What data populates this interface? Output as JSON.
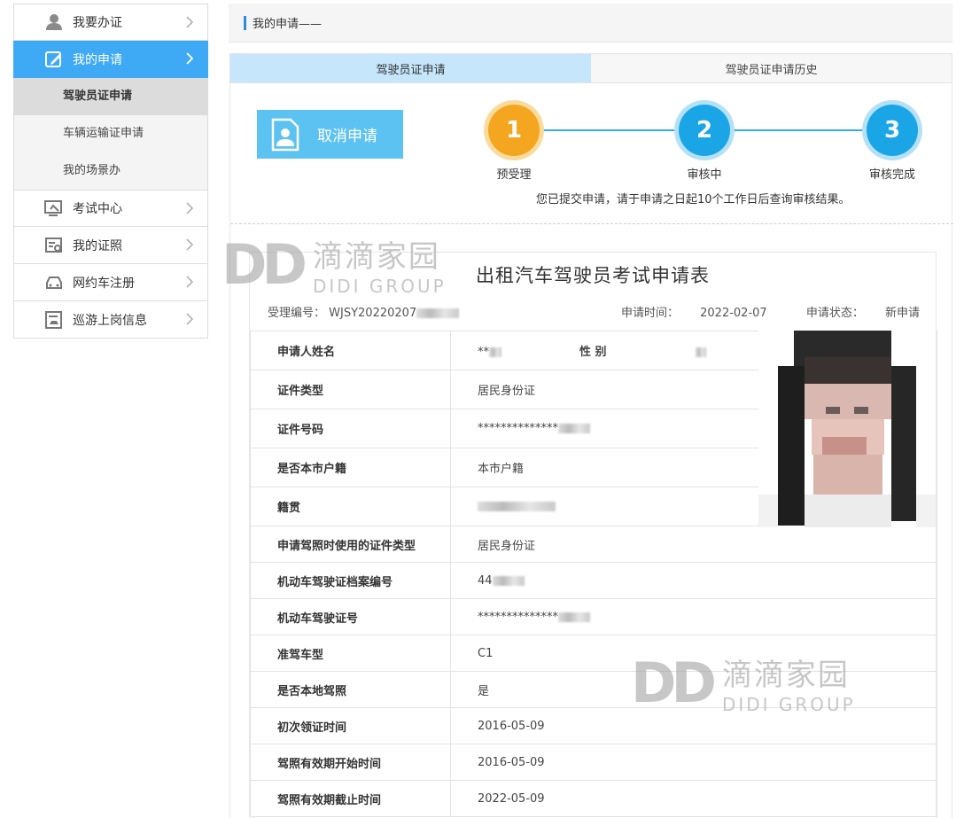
{
  "sidebar": {
    "items": [
      {
        "label": "我要办证",
        "icon": "person-icon"
      },
      {
        "label": "我的申请",
        "icon": "edit-icon"
      },
      {
        "label": "考试中心",
        "icon": "monitor-icon"
      },
      {
        "label": "我的证照",
        "icon": "certificate-icon"
      },
      {
        "label": "网约车注册",
        "icon": "car-icon"
      },
      {
        "label": "巡游上岗信息",
        "icon": "taxi-card-icon"
      }
    ],
    "submenu": [
      "驾驶员证申请",
      "车辆运输证申请",
      "我的场景办"
    ]
  },
  "breadcrumb": "我的申请——",
  "tabs": [
    "驾驶员证申请",
    "驾驶员证申请历史"
  ],
  "cancel_button": "取消申请",
  "steps": [
    {
      "num": "1",
      "label": "预受理",
      "color": "#f4a620"
    },
    {
      "num": "2",
      "label": "审核中",
      "color": "#1aa6e6"
    },
    {
      "num": "3",
      "label": "审核完成",
      "color": "#1aa6e6"
    }
  ],
  "notice": "您已提交申请，请于申请之日起10个工作日后查询审核结果。",
  "form": {
    "title": "出租汽车驾驶员考试申请表",
    "accept_no_label": "受理编号：",
    "accept_no": "WJSY20220207",
    "apply_time_label": "申请时间：",
    "apply_time": "2022-02-07",
    "status_label": "申请状态：",
    "status": "新申请",
    "gender_label": "性 别",
    "rows": [
      {
        "label": "申请人姓名",
        "value": "**"
      },
      {
        "label": "证件类型",
        "value": "居民身份证"
      },
      {
        "label": "证件号码",
        "value": "**************"
      },
      {
        "label": "是否本市户籍",
        "value": "本市户籍"
      },
      {
        "label": "籍贯",
        "value": ""
      },
      {
        "label": "申请驾照时使用的证件类型",
        "value": "居民身份证"
      },
      {
        "label": "机动车驾驶证档案编号",
        "value": "44"
      },
      {
        "label": "机动车驾驶证号",
        "value": "**************"
      },
      {
        "label": "准驾车型",
        "value": "C1"
      },
      {
        "label": "是否本地驾照",
        "value": "是"
      },
      {
        "label": "初次领证时间",
        "value": "2016-05-09"
      },
      {
        "label": "驾照有效期开始时间",
        "value": "2016-05-09"
      },
      {
        "label": "驾照有效期截止时间",
        "value": "2022-05-09"
      }
    ]
  },
  "watermark": {
    "logo": "DD",
    "cn": "滴滴家园",
    "en": "DIDI GROUP"
  },
  "colors": {
    "accent": "#3ea9f5",
    "step_orange": "#f4a620",
    "step_blue": "#1aa6e6",
    "tab_active": "#c5e6fb"
  }
}
